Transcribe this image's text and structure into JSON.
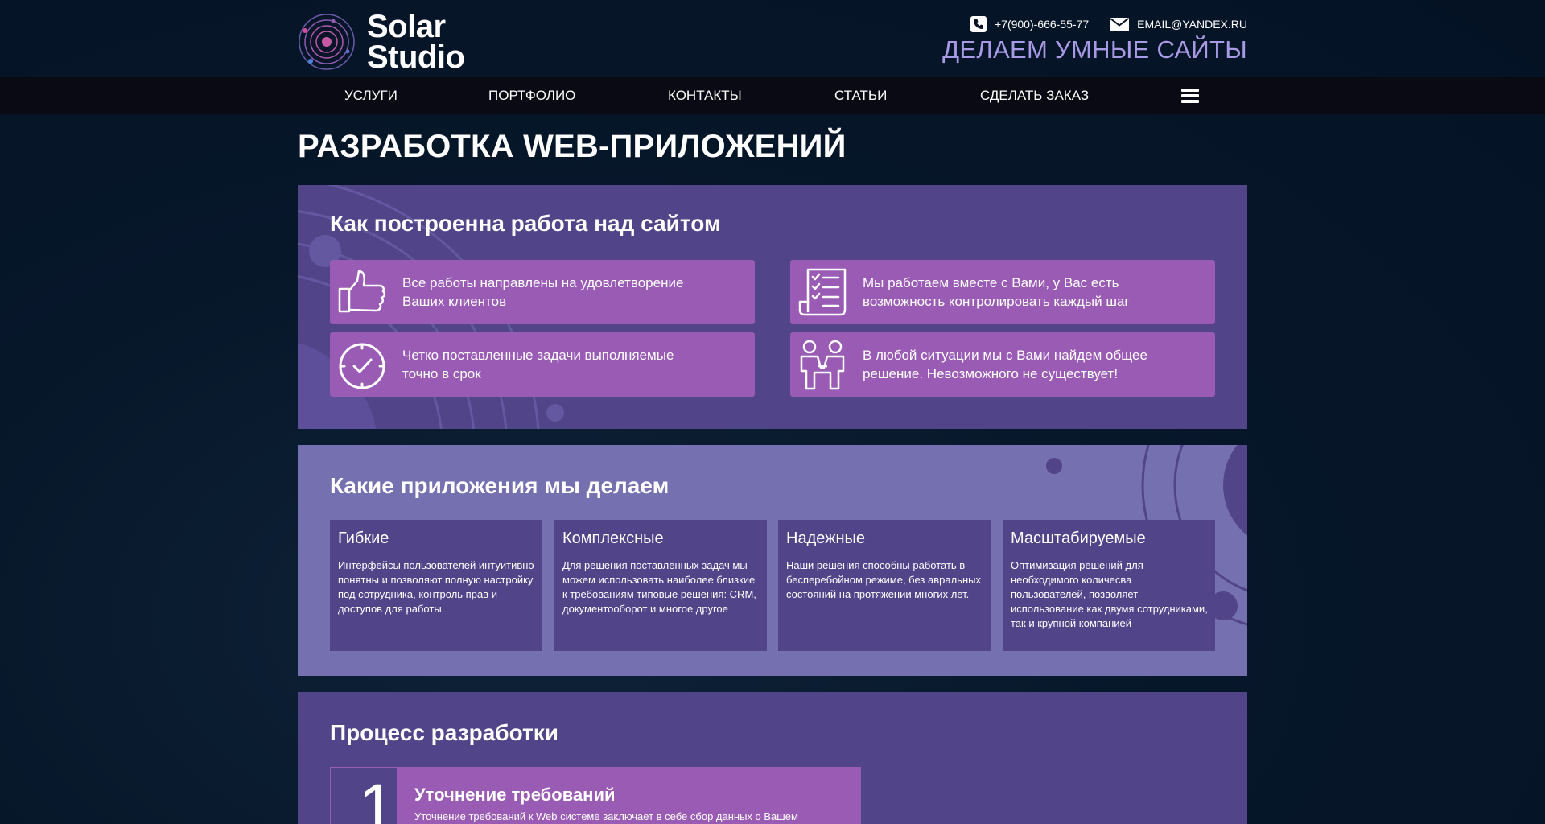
{
  "header": {
    "logo_line1": "Solar",
    "logo_line2": "Studio",
    "phone": "+7(900)-666-55-77",
    "email": "EMAIL@YANDEX.RU",
    "slogan": "ДЕЛАЕМ УМНЫЕ САЙТЫ"
  },
  "nav": {
    "items": [
      {
        "label": "УСЛУГИ"
      },
      {
        "label": "ПОРТФОЛИО"
      },
      {
        "label": "КОНТАКТЫ"
      },
      {
        "label": "СТАТЬИ"
      },
      {
        "label": "СДЕЛАТЬ ЗАКАЗ"
      }
    ],
    "menu_icon": "hamburger-icon"
  },
  "page": {
    "title": "РАЗРАБОТКА WEB-ПРИЛОЖЕНИЙ"
  },
  "how_we_work": {
    "title": "Как построенна работа над сайтом",
    "cards": [
      {
        "icon": "thumbs-up-icon",
        "text": "Все работы направлены на удовлетворение Ваших клиентов"
      },
      {
        "icon": "checklist-icon",
        "text": "Мы работаем вместе с Вами, у Вас есть возможность контролировать каждый шаг"
      },
      {
        "icon": "clock-check-icon",
        "text": "Четко поставленные задачи выполняемые точно в срок"
      },
      {
        "icon": "handshake-people-icon",
        "text": "В любой ситуации мы с Вами найдем общее решение. Невозможного не существует!"
      }
    ]
  },
  "app_types": {
    "title": "Какие приложения мы делаем",
    "cards": [
      {
        "title": "Гибкие",
        "text": "Интерфейсы пользователей интуитивно понятны и позволяют полную настройку под сотрудника, контроль прав и доступов для работы."
      },
      {
        "title": "Комплексные",
        "text": "Для решения поставленных задач мы можем использовать наиболее близкие к требованиям типовые решения: CRM, документооборот и многое другое"
      },
      {
        "title": "Надежные",
        "text": "Наши решения способны работать в бесперебойном режиме, без авральных состояний на протяжении многих лет."
      },
      {
        "title": "Масштабируемые",
        "text": "Оптимизация решений для необходимого количесва пользователей, позволяет использование как двумя сотрудниками, так и крупной компанией"
      }
    ]
  },
  "process": {
    "title": "Процесс разработки",
    "steps": [
      {
        "number": "1",
        "title": "Уточнение требований",
        "text": "Уточнение требований к Web системе заключает в себе сбор данных о Вашем"
      }
    ]
  },
  "colors": {
    "background": "#041224",
    "nav_bg": "#0a0a14",
    "section_dark": "#514488",
    "section_light": "#7570b0",
    "card_accent": "#9a5bb5",
    "slogan": "#a99ae6"
  }
}
